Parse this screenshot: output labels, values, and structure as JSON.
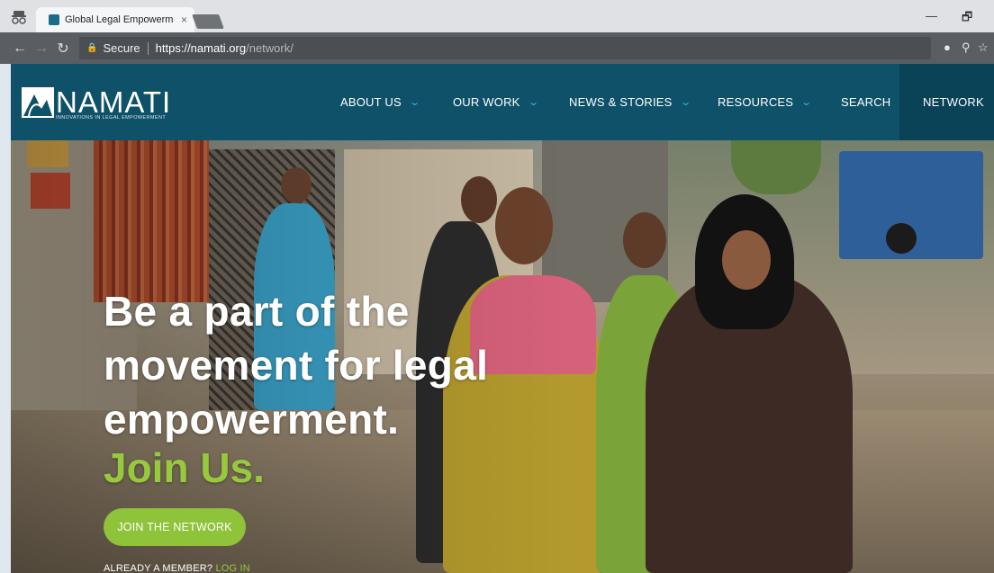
{
  "browser": {
    "tab_title": "Global Legal Empowerm",
    "close_glyph": "×",
    "secure_label": "Secure",
    "url_host": "https://namati.org",
    "url_path": "/network/",
    "back_icon": "arrow-left-icon",
    "forward_icon": "arrow-right-icon",
    "reload_icon": "reload-icon",
    "minimize_glyph": "—",
    "restore_glyph": "🗗"
  },
  "site": {
    "logo_word": "NAMATI",
    "logo_tagline": "INNOVATIONS IN LEGAL EMPOWERMENT",
    "brand_color": "#0e5169",
    "accent_green": "#8fc33a",
    "nav": [
      {
        "label": "ABOUT US",
        "has_dropdown": true
      },
      {
        "label": "OUR WORK",
        "has_dropdown": true
      },
      {
        "label": "NEWS & STORIES",
        "has_dropdown": true
      },
      {
        "label": "RESOURCES",
        "has_dropdown": true
      },
      {
        "label": "SEARCH",
        "has_dropdown": false
      },
      {
        "label": "NETWORK",
        "has_dropdown": true,
        "active": true
      }
    ]
  },
  "hero": {
    "headline_lines": [
      "Be a part of the",
      "movement for legal",
      "empowerment."
    ],
    "join_text": "Join Us.",
    "cta_label": "JOIN THE NETWORK",
    "member_text": "ALREADY A MEMBER?",
    "login_text": "LOG IN"
  }
}
